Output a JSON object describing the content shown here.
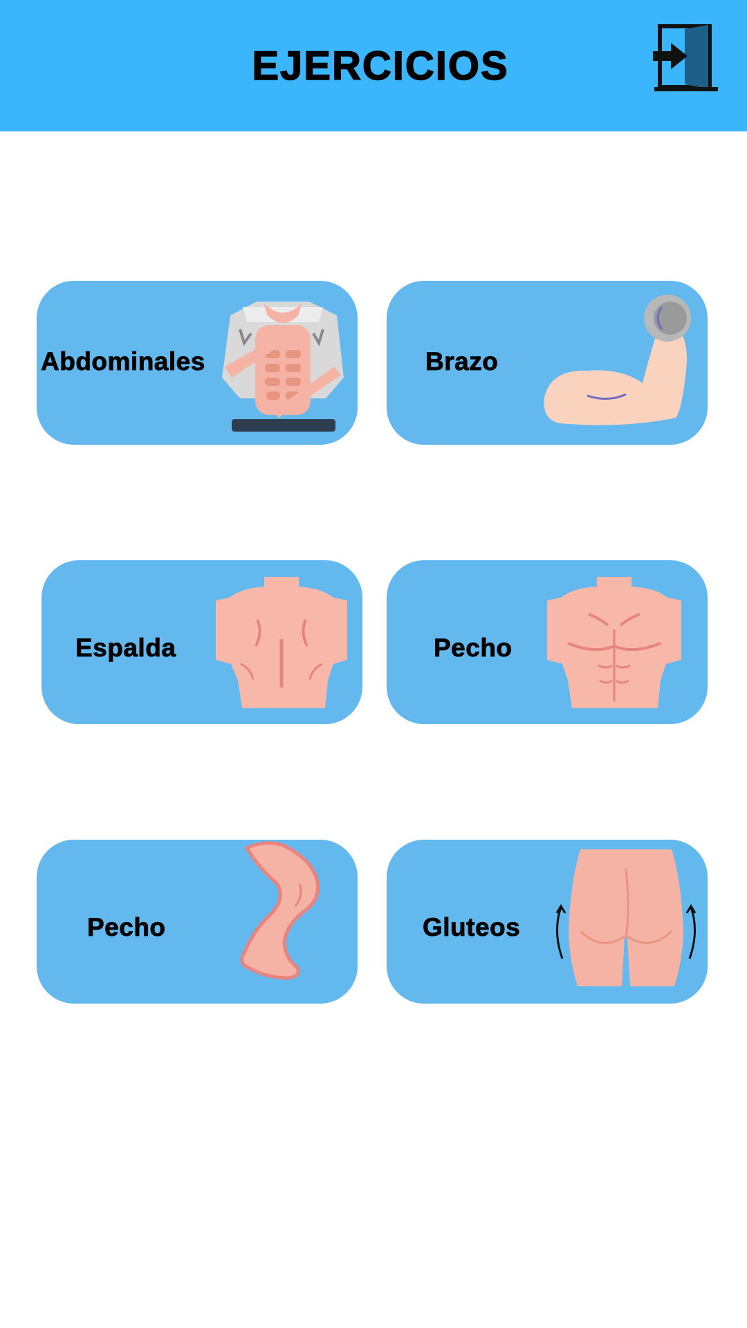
{
  "header": {
    "title": "EJERCICIOS",
    "logout_icon": "logout-door-icon",
    "background": "#3bb5fc"
  },
  "cards": [
    {
      "label": "Abdominales",
      "icon": "abs-torso-icon"
    },
    {
      "label": "Brazo",
      "icon": "flexed-arm-dumbbell-icon"
    },
    {
      "label": "Espalda",
      "icon": "back-torso-icon"
    },
    {
      "label": "Pecho",
      "icon": "chest-torso-icon"
    },
    {
      "label": "Pecho",
      "icon": "leg-icon"
    },
    {
      "label": "Gluteos",
      "icon": "glutes-icon"
    }
  ],
  "colors": {
    "card_background": "#63b8ee",
    "skin": "#f5b3a6",
    "skin_dark": "#e8857a"
  }
}
